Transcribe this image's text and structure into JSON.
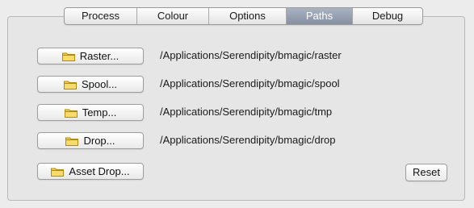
{
  "tabs": {
    "items": [
      {
        "label": "Process"
      },
      {
        "label": "Colour"
      },
      {
        "label": "Options"
      },
      {
        "label": "Paths"
      },
      {
        "label": "Debug"
      }
    ],
    "active": "Paths"
  },
  "folders": [
    {
      "button_label": "Raster...",
      "path": "/Applications/Serendipity/bmagic/raster"
    },
    {
      "button_label": "Spool...",
      "path": "/Applications/Serendipity/bmagic/spool"
    },
    {
      "button_label": "Temp...",
      "path": "/Applications/Serendipity/bmagic/tmp"
    },
    {
      "button_label": "Drop...",
      "path": "/Applications/Serendipity/bmagic/drop"
    },
    {
      "button_label": "Asset Drop...",
      "path": ""
    }
  ],
  "reset_label": "Reset",
  "icons": {
    "folder_button": "folder-icon"
  },
  "colors": {
    "active_tab": "#8f9aab",
    "folder": "#f2cf4a"
  }
}
